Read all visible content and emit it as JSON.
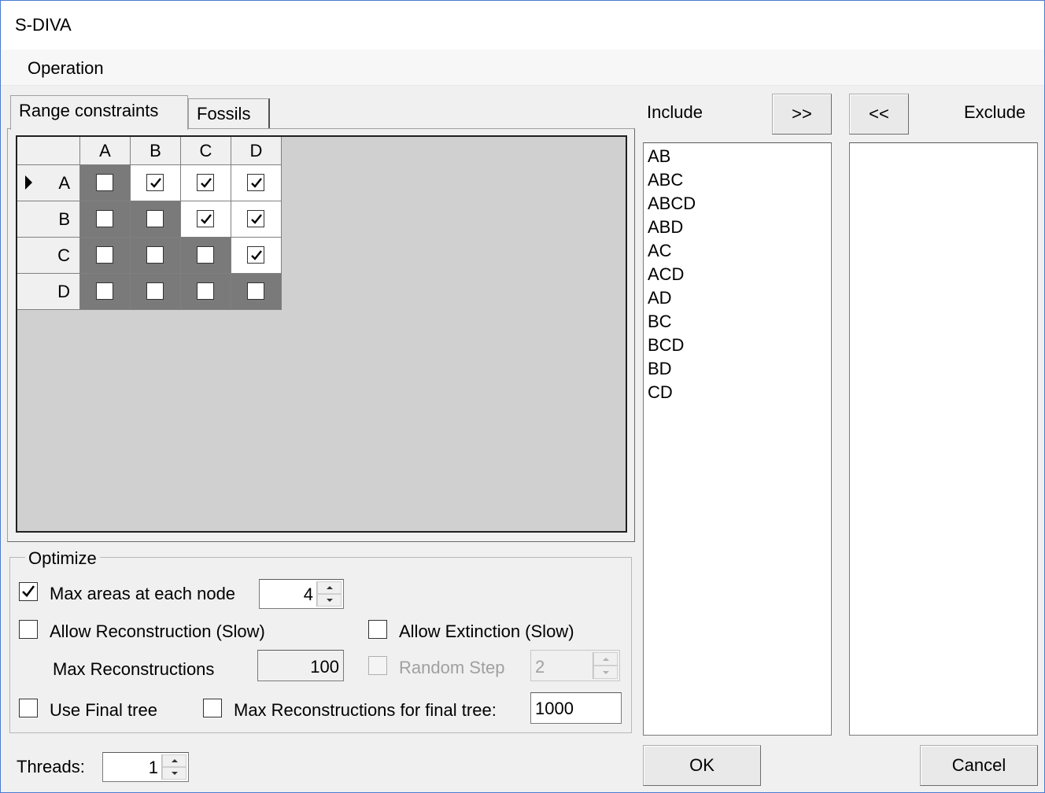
{
  "window": {
    "title": "S-DIVA"
  },
  "menu": {
    "items": [
      "Operation"
    ]
  },
  "tabs": [
    {
      "label": "Range constraints",
      "active": true
    },
    {
      "label": "Fossils",
      "active": false
    }
  ],
  "grid": {
    "columns": [
      "A",
      "B",
      "C",
      "D"
    ],
    "rows": [
      {
        "label": "A",
        "current": true,
        "checks": [
          false,
          true,
          true,
          true
        ]
      },
      {
        "label": "B",
        "current": false,
        "checks": [
          false,
          false,
          true,
          true
        ]
      },
      {
        "label": "C",
        "current": false,
        "checks": [
          false,
          false,
          false,
          true
        ]
      },
      {
        "label": "D",
        "current": false,
        "checks": [
          false,
          false,
          false,
          false
        ]
      }
    ]
  },
  "include": {
    "label": "Include",
    "move_button": ">>",
    "items": [
      "AB",
      "ABC",
      "ABCD",
      "ABD",
      "AC",
      "ACD",
      "AD",
      "BC",
      "BCD",
      "BD",
      "CD"
    ]
  },
  "exclude": {
    "label": "Exclude",
    "move_button": "<<",
    "items": []
  },
  "optimize": {
    "legend": "Optimize",
    "max_areas": {
      "label": "Max areas at each node",
      "checked": true,
      "value": "4"
    },
    "allow_reconstruction": {
      "label": "Allow Reconstruction (Slow)",
      "checked": false
    },
    "allow_extinction": {
      "label": "Allow Extinction (Slow)",
      "checked": false
    },
    "max_reconstructions": {
      "label": "Max Reconstructions",
      "value": "100"
    },
    "random_step": {
      "label": "Random Step",
      "checked": false,
      "value": "2"
    },
    "use_final_tree": {
      "label": "Use Final tree",
      "checked": false
    },
    "max_recon_final": {
      "label": "Max Reconstructions for final tree:",
      "checked": false,
      "value": "1000"
    }
  },
  "threads": {
    "label": "Threads:",
    "value": "1"
  },
  "buttons": {
    "ok": "OK",
    "cancel": "Cancel"
  },
  "colors": {
    "diagonal_below": "#7a7a7a",
    "above": "#ffffff",
    "grid_bg": "#d0d0d0"
  }
}
